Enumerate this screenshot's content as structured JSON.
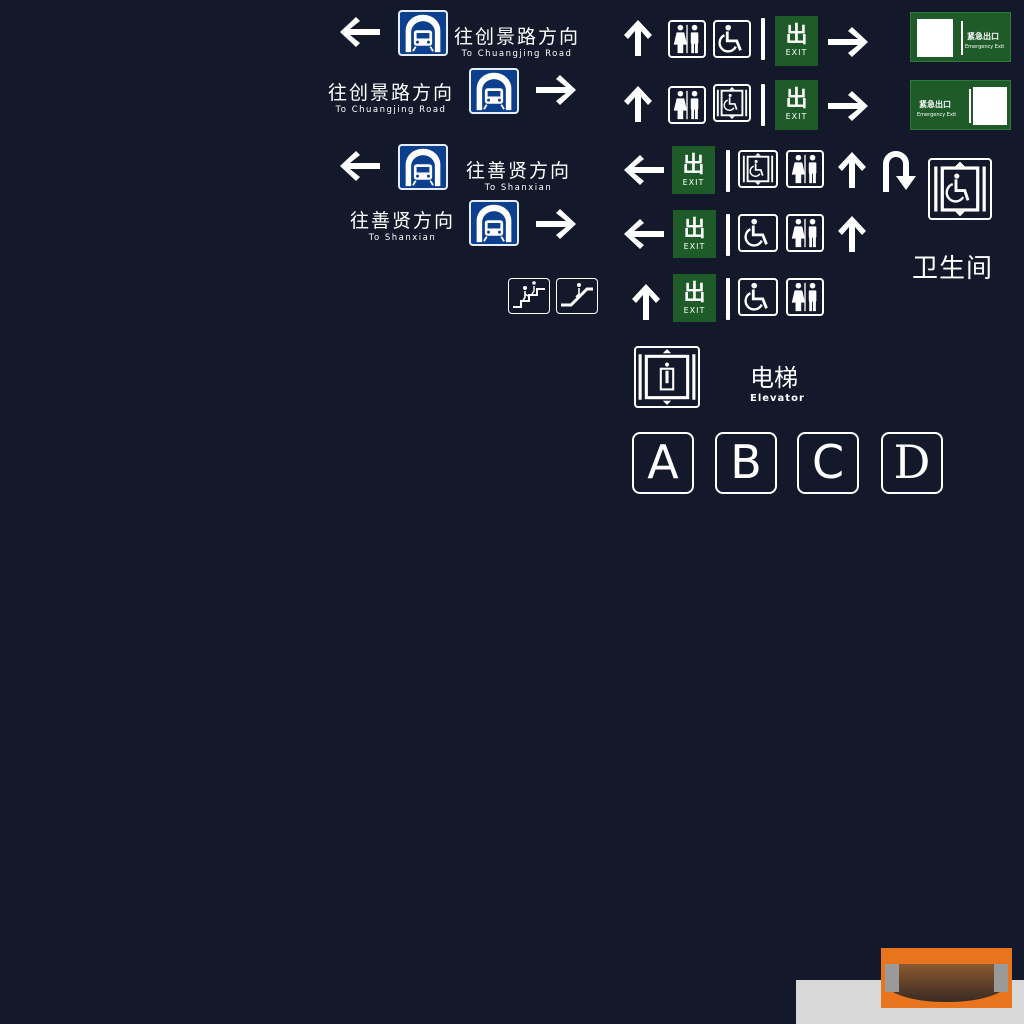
{
  "colors": {
    "background": "#13192a",
    "metro_blue": "#0d3f8f",
    "exit_green": "#1e5b28",
    "sign_white": "#ffffff",
    "slab_orange": "#e8741e",
    "slab_grey": "#d8d8d8"
  },
  "direction_signs": [
    {
      "cn": "往创景路方向",
      "en": "To Chuangjing Road"
    },
    {
      "cn": "往创景路方向",
      "en": "To Chuangjing Road"
    },
    {
      "cn": "往善贤方向",
      "en": "To Shanxian"
    },
    {
      "cn": "往善贤方向",
      "en": "To Shanxian"
    }
  ],
  "exit_badge": {
    "cn": "出",
    "en": "EXIT"
  },
  "emergency_exit": {
    "cn": "紧急出口",
    "en": "Emergency Exit"
  },
  "toilet_label": "卫生间",
  "elevator": {
    "cn": "电梯",
    "en": "Elevator"
  },
  "letters": [
    "A",
    "B",
    "C",
    "D"
  ],
  "icons": [
    "arrow-left-icon",
    "arrow-right-icon",
    "arrow-up-icon",
    "u-turn-icon",
    "metro-train-icon",
    "toilet-icon",
    "wheelchair-icon",
    "accessible-elevator-icon",
    "elevator-icon",
    "stairs-icon",
    "escalator-icon",
    "running-man-icon"
  ]
}
